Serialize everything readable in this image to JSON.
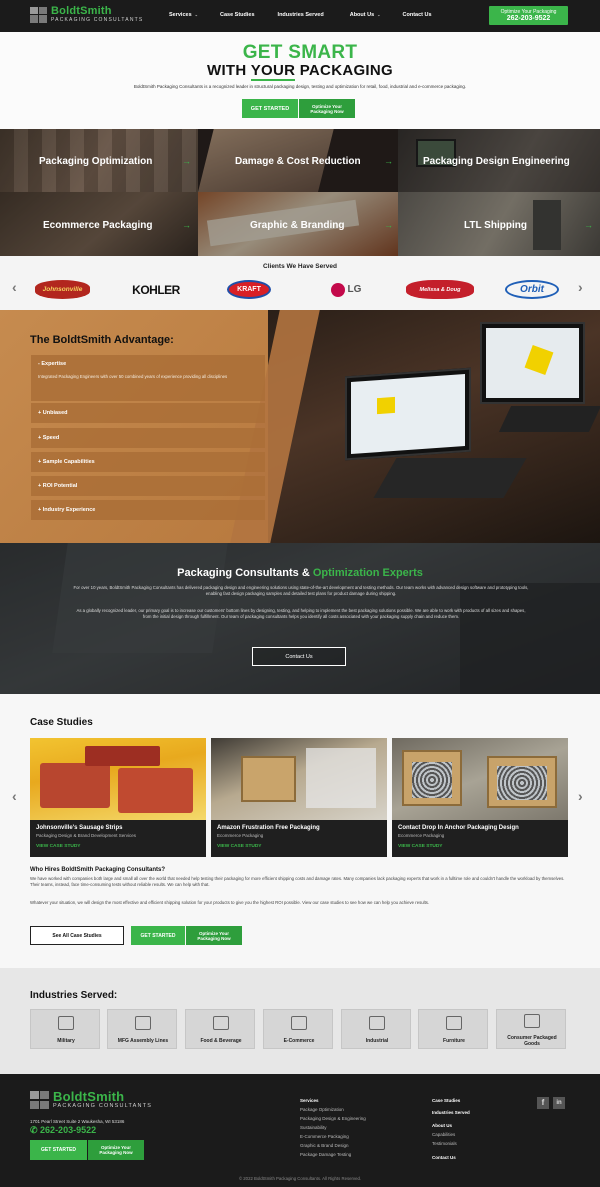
{
  "header": {
    "brand": "BoldtSmith",
    "brand_sub": "PACKAGING CONSULTANTS",
    "nav": [
      "Services",
      "Case Studies",
      "Industries Served",
      "About Us",
      "Contact Us"
    ],
    "cta_line1": "Optimize Your Packaging",
    "cta_line2": "262-203-9522"
  },
  "hero": {
    "title_line1": "GET SMART",
    "title_line2_pre": "WITH ",
    "title_line2_em": "YOUR",
    "title_line2_post": " PACKAGING",
    "description": "BoldtSmith Packaging Consultants is a recognized leader in structural packaging design, testing and optimization for retail, food, industrial and e-commerce packaging.",
    "btn_start": "GET STARTED",
    "btn_opt_line1": "Optimize Your",
    "btn_opt_line2": "Packaging Now"
  },
  "services": [
    {
      "label": "Packaging Optimization"
    },
    {
      "label": "Damage & Cost Reduction"
    },
    {
      "label": "Packaging Design Engineering"
    },
    {
      "label": "Ecommerce Packaging"
    },
    {
      "label": "Graphic & Branding"
    },
    {
      "label": "LTL Shipping"
    }
  ],
  "clients": {
    "title": "Clients We Have Served",
    "logos": [
      "Johnsonville",
      "KOHLER",
      "KRAFT",
      "LG",
      "Melissa & Doug",
      "Orbit"
    ]
  },
  "advantage": {
    "title": "The BoldtSmith Advantage:",
    "items": [
      {
        "label": "Expertise",
        "detail": "Integrated Packaging Engineers with over 50 combined years of experience providing all disciplines"
      },
      {
        "label": "Unbiased"
      },
      {
        "label": "Speed"
      },
      {
        "label": "Sample Capabilities"
      },
      {
        "label": "ROI Potential"
      },
      {
        "label": "Industry Experience"
      }
    ]
  },
  "consultants": {
    "title_pre": "Packaging Consultants & ",
    "title_em": "Optimization Experts",
    "para1": "For over 10 years, BoldtSmith Packaging Consultants has delivered packaging design and engineering solutions using state-of-the-art development and testing methods. Our team works with advanced design software and prototyping tools, enabling fast design packaging samples and detailed test plans for product damage during shipping.",
    "para2": "As a globally recognized leader, our primary goal is to increase our customers' bottom lines by designing, testing, and helping to implement the best packaging solutions possible. We are able to work with products of all sizes and shapes, from the initial design through fulfillment. Our team of packaging consultants helps you identify all costs associated with your packaging supply chain and reduce them.",
    "btn": "Contact Us"
  },
  "case_studies": {
    "title": "Case Studies",
    "cards": [
      {
        "title": "Johnsonville's Sausage Strips",
        "subtitle": "Packaging Design & Brand Development Services",
        "link": "VIEW CASE STUDY"
      },
      {
        "title": "Amazon Frustration Free Packaging",
        "subtitle": "Ecommerce Packaging",
        "link": "VIEW CASE STUDY"
      },
      {
        "title": "Contact Drop In Anchor Packaging Design",
        "subtitle": "Ecommerce Packaging",
        "link": "VIEW CASE STUDY"
      }
    ],
    "who_title": "Who Hires BoldtSmith Packaging Consultants?",
    "who_p1": "We have worked with companies both large and small all over the world that needed help testing their packaging for more efficient shipping costs and damage rates. Many companies lack packaging experts that work in a fulltime role and couldn't handle the workload by themselves. Their teams, instead, face time-consuming tests without reliable results. We can help with that.",
    "who_p2": "Whatever your situation, we will design the most effective and efficient shipping solution for your products to give you the highest ROI possible. View our case studies to see how we can help you achieve results.",
    "btn_all": "See All Case Studies",
    "btn_start": "GET STARTED",
    "btn_opt_line1": "Optimize Your",
    "btn_opt_line2": "Packaging Now"
  },
  "industries": {
    "title": "Industries Served:",
    "items": [
      "Military",
      "MFG Assembly Lines",
      "Food & Beverage",
      "E-Commerce",
      "Industrial",
      "Furniture",
      "Consumer Packaged Goods"
    ]
  },
  "footer": {
    "address": "1701 Pearl Street Suite 2 Waukesha, WI 53186",
    "phone": "262-203-9522",
    "btn_start": "GET STARTED",
    "btn_opt_line1": "Optimize Your",
    "btn_opt_line2": "Packaging Now",
    "col1_title": "Services",
    "col1_items": [
      "Package Optimization",
      "Packaging Design & Engineering",
      "Sustainability",
      "E-Commerce Packaging",
      "Graphic & Brand Design",
      "Package Damage Testing"
    ],
    "col2_items": [
      "Case Studies",
      "Industries Served",
      "About Us",
      "Capabilities",
      "Testimonials",
      "Contact Us"
    ],
    "copyright": "© 2022 BoldtSmith Packaging Consultants. All Rights Reserved."
  },
  "colors": {
    "accent": "#3bb54a",
    "dark": "#1b1b1b"
  }
}
